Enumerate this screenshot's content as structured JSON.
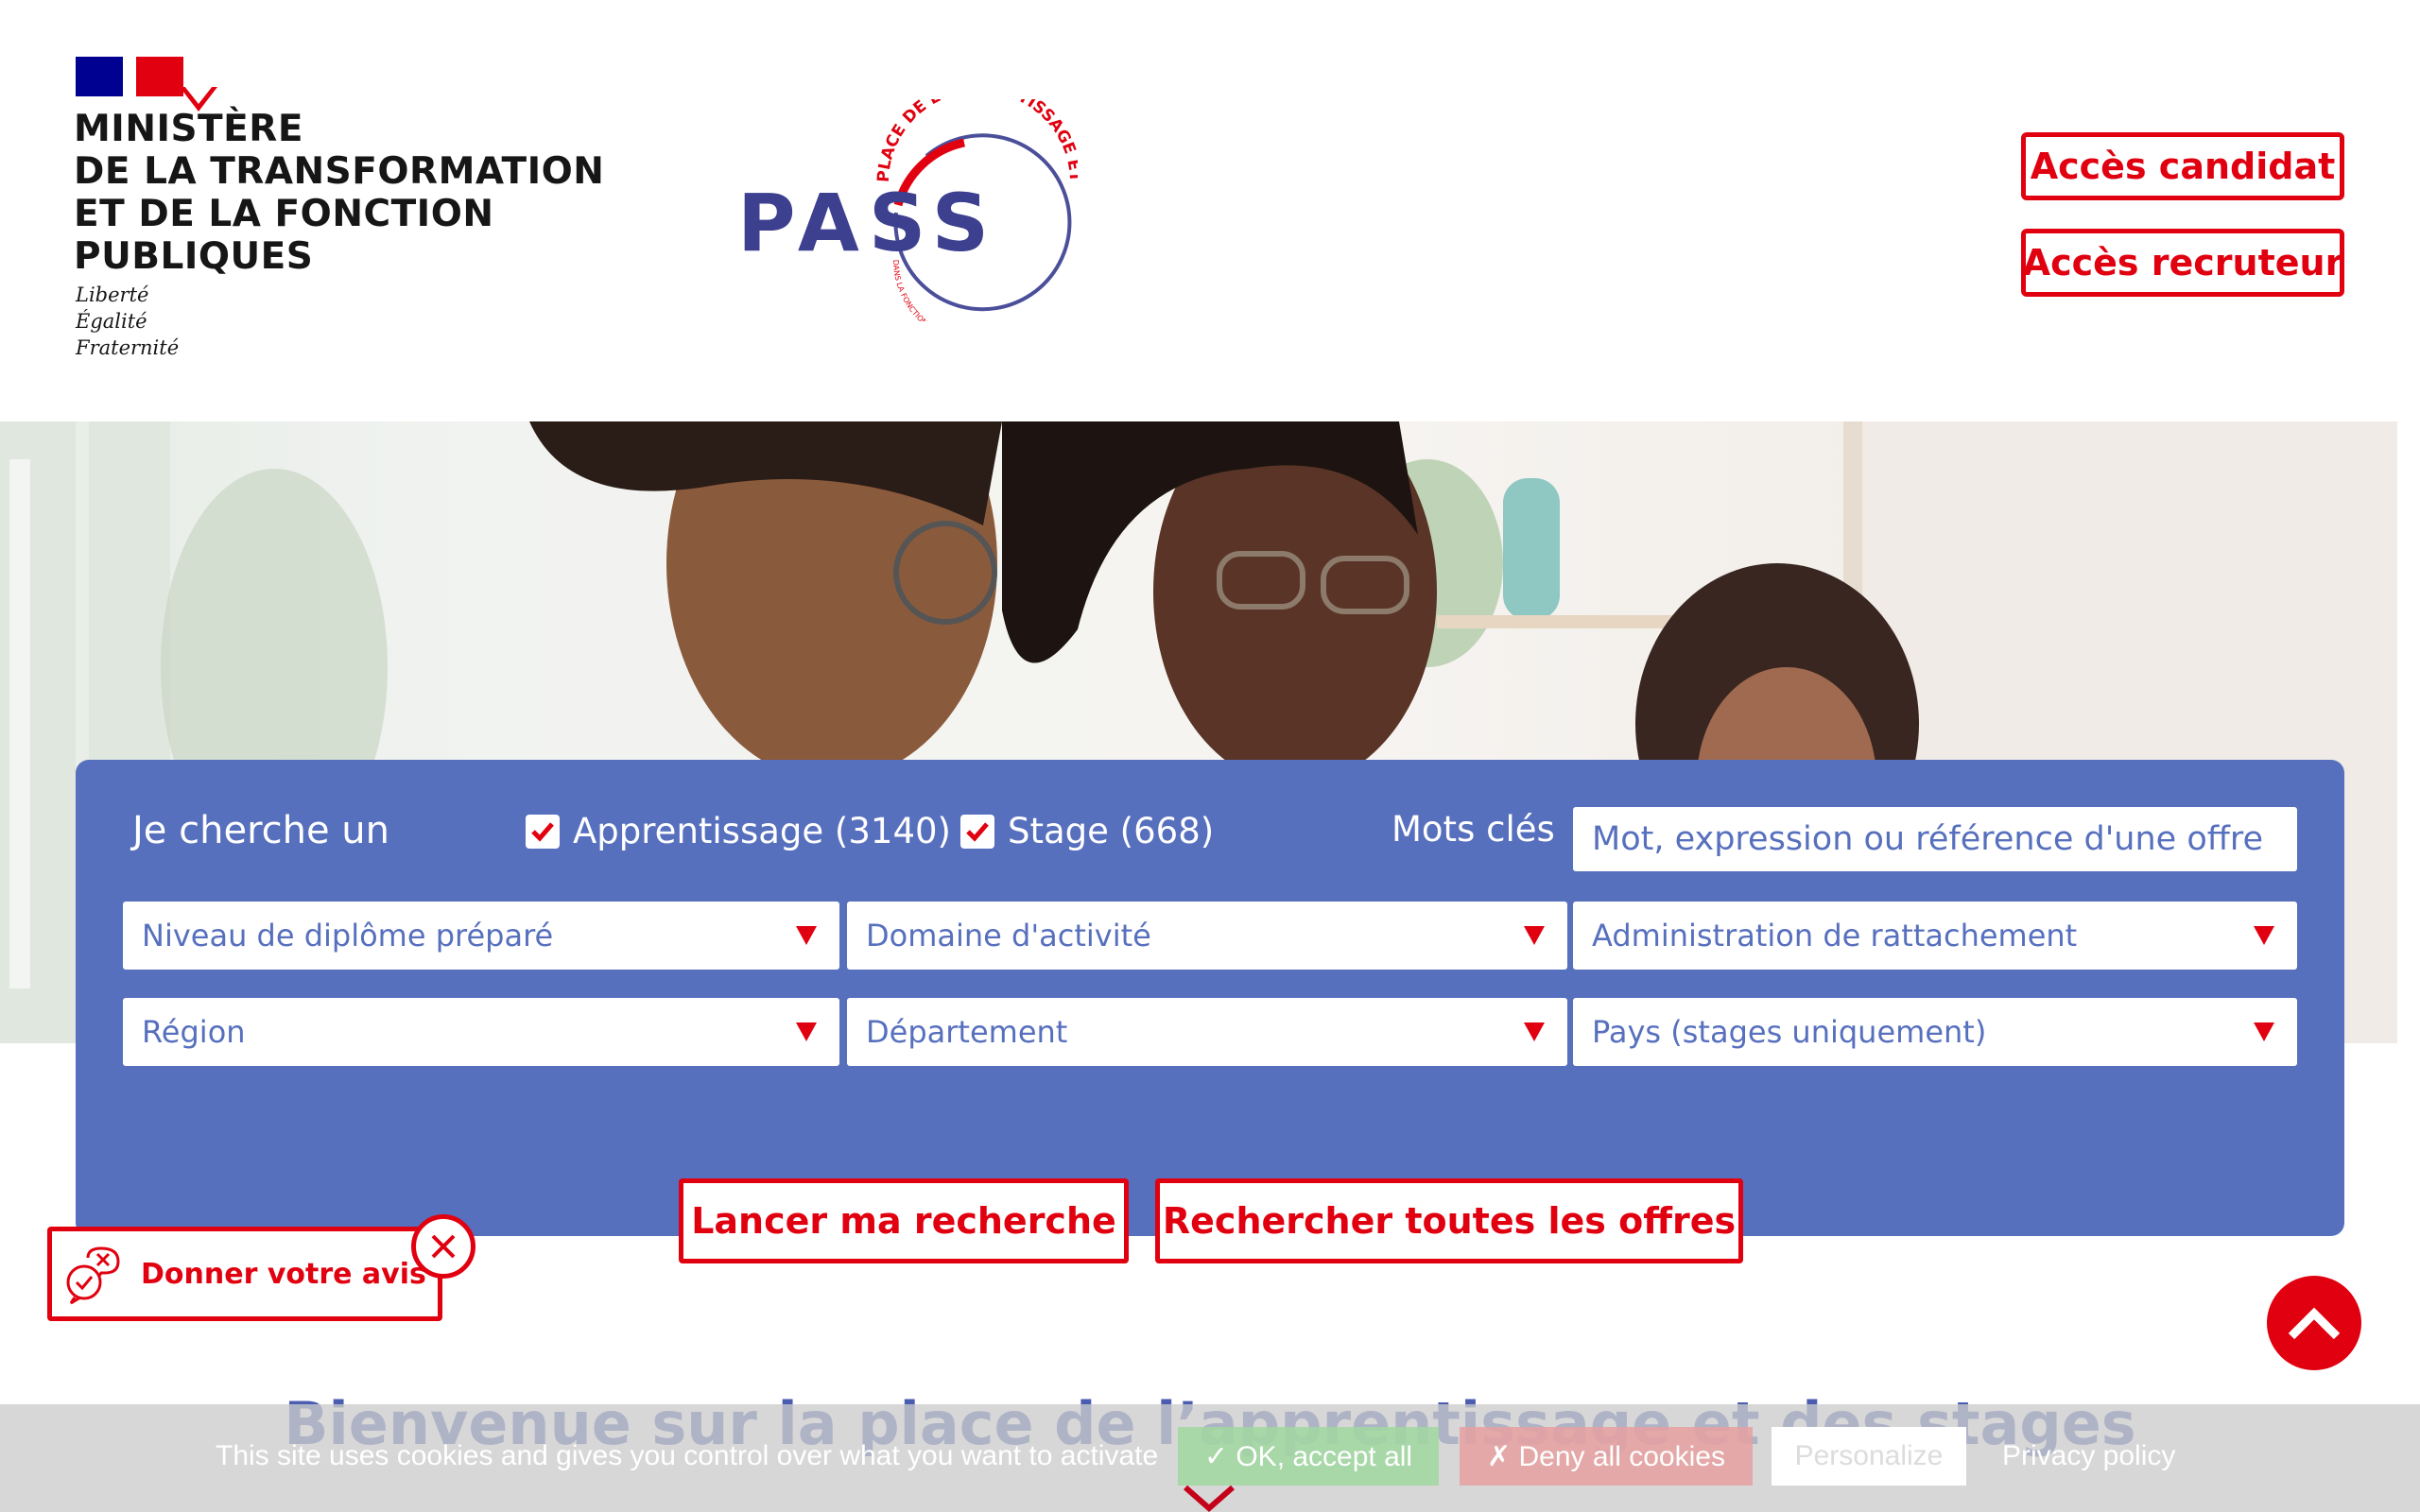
{
  "header": {
    "ministry_lines": [
      "MINISTÈRE",
      "DE LA TRANSFORMATION",
      "ET DE LA FONCTION",
      "PUBLIQUES"
    ],
    "motto_lines": [
      "Liberté",
      "Égalité",
      "Fraternité"
    ],
    "logo": {
      "wordmark": "PASS",
      "arc_text_top": "PLACE DE L'APPRENTISSAGE ET DES STAGES",
      "arc_text_bottom": "DANS LA FONCTION PUBLIQUE"
    },
    "access_candidate": "Accès candidat",
    "access_recruiter": "Accès recruteur"
  },
  "search": {
    "label": "Je cherche un",
    "apprenticeship": {
      "label": "Apprentissage (3140)",
      "checked": true
    },
    "internship": {
      "label": "Stage (668)",
      "checked": true
    },
    "keywords_label": "Mots clés",
    "keywords_placeholder": "Mot, expression ou référence d'une offre",
    "selects": {
      "diploma": "Niveau de diplôme préparé",
      "domain": "Domaine d'activité",
      "administration": "Administration de rattachement",
      "region": "Région",
      "department": "Département",
      "country": "Pays (stages uniquement)"
    },
    "launch_button": "Lancer ma recherche",
    "all_offers_button": "Rechercher toutes les offres"
  },
  "feedback": {
    "label": "Donner votre avis"
  },
  "welcome_title": "Bienvenue sur la place de l’apprentissage et des stages",
  "cookies": {
    "text": "This site uses cookies and gives you control over what you want to activate",
    "accept": "✓ OK, accept all",
    "deny": "✗ Deny all cookies",
    "personalize": "Personalize",
    "privacy": "Privacy policy"
  },
  "colors": {
    "brand_red": "#e1000f",
    "panel_blue": "#5770be",
    "title_blue": "#4b5db0",
    "republic_blue": "#000091"
  },
  "icons": [
    "check-icon",
    "dropdown-arrow-icon",
    "feedback-chat-icon",
    "close-icon",
    "chevron-up-icon",
    "chevron-down-icon"
  ]
}
